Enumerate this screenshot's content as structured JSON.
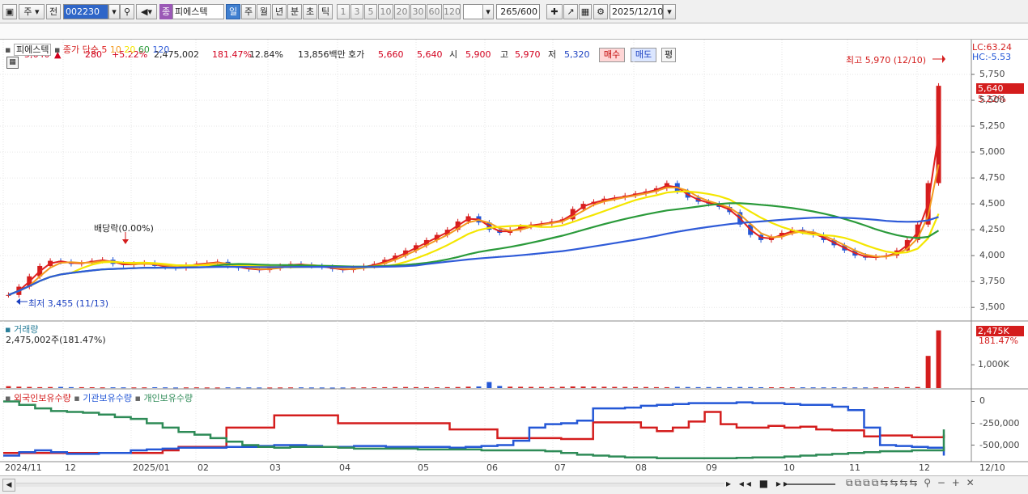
{
  "toolbar": {
    "market_label": "주",
    "prev_label": "전",
    "code_value": "002230",
    "company_badge": "종",
    "company_name": "피에스텍",
    "period_tabs": [
      "일",
      "주",
      "월",
      "년",
      "분",
      "초",
      "틱"
    ],
    "minute_options": [
      "1",
      "3",
      "5",
      "10",
      "20",
      "30",
      "60",
      "120"
    ],
    "bar_count": "265",
    "bar_total": "/600",
    "date_value": "2025/12/10"
  },
  "quote": {
    "price": "5,640",
    "up_arrow": "▲",
    "change": "280",
    "change_pct": "+5.22%",
    "volume": "2,475,002",
    "volume_ratio": "181.47%",
    "turnover": "12.84%",
    "trade_value": "13,856백만",
    "bid_label": "호가",
    "bid1": "5,660",
    "bid2": "5,640",
    "open_label": "시",
    "open": "5,900",
    "high_label": "고",
    "high": "5,970",
    "low_label": "저",
    "low": "5,320",
    "buy_button": "매수",
    "sell_button": "매도",
    "eval_button": "평"
  },
  "price_panel": {
    "legend_name": "피에스텍",
    "legend_ma": "종가 단순",
    "ma_periods": [
      "5",
      "10",
      "20",
      "60",
      "120"
    ],
    "ma_colors": [
      "#e02020",
      "#f39a1f",
      "#f4e600",
      "#2a9a3a",
      "#2f5bd8"
    ],
    "lc_label": "LC:63.24",
    "hc_label": "HC:-5.53",
    "high_annotation": "최고 5,970 (12/10)",
    "low_annotation": "최저 3,455 (11/13)",
    "dividend_annotation": "배당락(0.00%)",
    "current_price_tag": "5,640",
    "current_pct_tag": "5.22%",
    "y_ticks": [
      "5,750",
      "5,500",
      "5,250",
      "5,000",
      "4,750",
      "4,500",
      "4,250",
      "4,000",
      "3,750",
      "3,500"
    ]
  },
  "volume_panel": {
    "title": "거래량",
    "value_text": "2,475,002주(181.47%)",
    "tag_value": "2,475K",
    "tag_pct": "181.47%",
    "y_tick": "1,000K"
  },
  "holdings_panel": {
    "series": [
      "외국인보유수량",
      "기관보유수량",
      "개인보유수량"
    ],
    "series_colors": [
      "#d41d1d",
      "#2457d6",
      "#2e8b57"
    ],
    "y_ticks": [
      "0",
      "-250,000",
      "-500,000"
    ]
  },
  "x_axis": [
    "2024/11",
    "12",
    "2025/01",
    "02",
    "03",
    "04",
    "05",
    "06",
    "07",
    "08",
    "09",
    "10",
    "11",
    "12",
    "12/10"
  ],
  "chart_data": {
    "type": "line",
    "price_close": [
      3620,
      3700,
      3800,
      3900,
      3950,
      3940,
      3920,
      3930,
      3950,
      3960,
      3920,
      3910,
      3920,
      3930,
      3900,
      3890,
      3880,
      3910,
      3920,
      3930,
      3940,
      3900,
      3880,
      3870,
      3860,
      3880,
      3900,
      3920,
      3910,
      3900,
      3890,
      3870,
      3860,
      3880,
      3900,
      3920,
      3960,
      4000,
      4050,
      4100,
      4150,
      4200,
      4250,
      4330,
      4380,
      4320,
      4250,
      4220,
      4250,
      4280,
      4300,
      4310,
      4330,
      4350,
      4450,
      4500,
      4520,
      4550,
      4560,
      4580,
      4600,
      4620,
      4650,
      4700,
      4620,
      4560,
      4520,
      4500,
      4470,
      4420,
      4300,
      4200,
      4150,
      4180,
      4220,
      4250,
      4230,
      4200,
      4150,
      4100,
      4050,
      4000,
      3980,
      3990,
      4000,
      4050,
      4150,
      4300,
      4700,
      5640
    ],
    "volume_k": [
      80,
      60,
      50,
      40,
      45,
      50,
      40,
      38,
      35,
      30,
      32,
      30,
      28,
      30,
      35,
      30,
      25,
      28,
      30,
      26,
      25,
      30,
      28,
      27,
      25,
      24,
      26,
      28,
      30,
      26,
      25,
      22,
      24,
      26,
      30,
      34,
      38,
      42,
      45,
      40,
      38,
      35,
      40,
      45,
      60,
      70,
      260,
      90,
      60,
      55,
      50,
      48,
      45,
      55,
      70,
      65,
      60,
      55,
      50,
      48,
      45,
      45,
      40,
      38,
      50,
      45,
      40,
      42,
      40,
      38,
      45,
      42,
      36,
      35,
      34,
      33,
      32,
      30,
      30,
      32,
      30,
      28,
      28,
      30,
      32,
      35,
      40,
      45,
      1380,
      2475
    ],
    "series": [
      {
        "name": "외국인보유수량",
        "values": [
          -590000,
          -590000,
          -590000,
          -590000,
          -590000,
          -590000,
          -590000,
          -590000,
          -590000,
          -590000,
          -560000,
          -520000,
          -520000,
          -520000,
          -300000,
          -300000,
          -300000,
          -160000,
          -160000,
          -160000,
          -160000,
          -250000,
          -250000,
          -250000,
          -250000,
          -250000,
          -250000,
          -250000,
          -320000,
          -320000,
          -320000,
          -420000,
          -420000,
          -420000,
          -420000,
          -430000,
          -430000,
          -240000,
          -240000,
          -240000,
          -300000,
          -340000,
          -300000,
          -230000,
          -120000,
          -260000,
          -300000,
          -300000,
          -280000,
          -300000,
          -290000,
          -320000,
          -330000,
          -330000,
          -400000,
          -390000,
          -390000,
          -410000,
          -410000,
          -380000
        ]
      },
      {
        "name": "기관보유수량",
        "values": [
          -620000,
          -580000,
          -560000,
          -580000,
          -600000,
          -600000,
          -590000,
          -590000,
          -560000,
          -550000,
          -540000,
          -530000,
          -530000,
          -530000,
          -520000,
          -520000,
          -510000,
          -500000,
          -500000,
          -510000,
          -520000,
          -520000,
          -510000,
          -510000,
          -520000,
          -520000,
          -520000,
          -520000,
          -530000,
          -520000,
          -510000,
          -500000,
          -450000,
          -300000,
          -260000,
          -250000,
          -220000,
          -80000,
          -80000,
          -70000,
          -50000,
          -40000,
          -30000,
          -20000,
          -20000,
          -20000,
          -10000,
          -20000,
          -20000,
          -30000,
          -40000,
          -40000,
          -60000,
          -100000,
          -300000,
          -500000,
          -510000,
          -520000,
          -530000,
          -620000
        ]
      },
      {
        "name": "개인보유수량",
        "values": [
          0,
          -40000,
          -80000,
          -110000,
          -120000,
          -130000,
          -150000,
          -180000,
          -200000,
          -250000,
          -300000,
          -350000,
          -380000,
          -420000,
          -460000,
          -500000,
          -520000,
          -530000,
          -520000,
          -520000,
          -520000,
          -530000,
          -540000,
          -540000,
          -540000,
          -540000,
          -550000,
          -550000,
          -550000,
          -550000,
          -560000,
          -560000,
          -560000,
          -560000,
          -570000,
          -590000,
          -610000,
          -620000,
          -630000,
          -640000,
          -640000,
          -650000,
          -650000,
          -650000,
          -650000,
          -650000,
          -645000,
          -640000,
          -640000,
          -630000,
          -620000,
          -610000,
          -600000,
          -590000,
          -580000,
          -570000,
          -570000,
          -560000,
          -560000,
          -320000
        ]
      }
    ],
    "ylim_price": [
      3400,
      6000
    ],
    "ylim_holdings": [
      -680000,
      60000
    ]
  }
}
